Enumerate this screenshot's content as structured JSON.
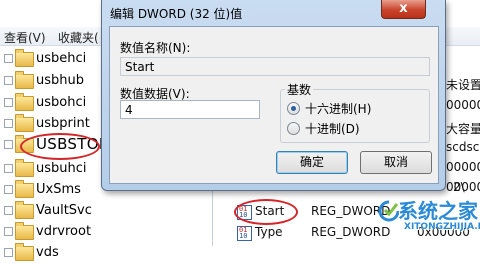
{
  "registry": {
    "menu": [
      "查看(V)",
      "收藏夹("
    ],
    "tree": [
      "usbehci",
      "usbhub",
      "usbohci",
      "usbprint",
      "USBSTOR",
      "usbuhci",
      "UxSms",
      "VaultSvc",
      "vdrvroot",
      "vds"
    ],
    "right_fragments": {
      "r1": "未设置",
      "r2": "00000",
      "r3": "大容量",
      "r4": "scdsc.i",
      "r5": "00000",
      "r6": "00000",
      "r7": "2\\"
    },
    "values": [
      {
        "name": "Start",
        "type": "REG_DWORD",
        "data": ""
      },
      {
        "name": "Type",
        "type": "REG_DWORD",
        "data": "0x00000"
      }
    ]
  },
  "dialog": {
    "title": "编辑 DWORD (32 位)值",
    "close_label": "x",
    "name_label": "数值名称(N):",
    "name_value": "Start",
    "data_label": "数值数据(V):",
    "data_value": "4",
    "base_label": "基数",
    "radix_options": [
      {
        "label": "十六进制(H)",
        "checked": true
      },
      {
        "label": "十进制(D)",
        "checked": false
      }
    ],
    "ok_label": "确定",
    "cancel_label": "取消"
  },
  "watermark": {
    "title": "系统之家",
    "url": "XITONGZHIJIA.NET"
  },
  "colors": {
    "highlight_ellipse": "#d4262a",
    "dialog_frame": "#b4cde9",
    "watermark": "#2b8ad6"
  }
}
